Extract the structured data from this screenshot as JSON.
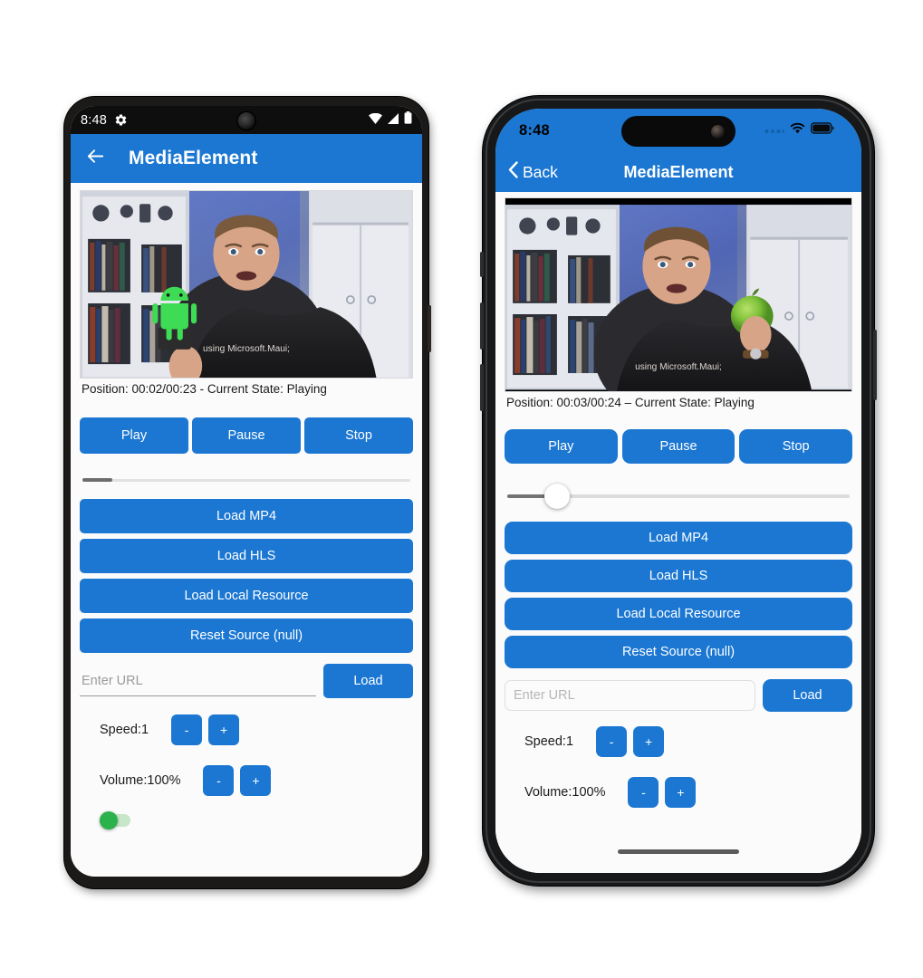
{
  "app": {
    "title": "MediaElement",
    "accent_color": "#1b77d2",
    "position_label_android": "Position: 00:02/00:23 - Current State: Playing",
    "position_label_ios": "Position: 00:03/00:24 – Current State: Playing"
  },
  "android": {
    "status_bar": {
      "time": "8:48",
      "gear_icon": "gear-icon",
      "wifi_icon": "wifi-icon",
      "signal_icon": "cellular-signal-icon",
      "battery_icon": "battery-icon"
    },
    "appbar": {
      "back_icon": "arrow-back-icon",
      "title": "MediaElement"
    },
    "transport": {
      "play": "Play",
      "pause": "Pause",
      "stop": "Stop"
    },
    "progress_percent": 9,
    "source_buttons": [
      "Load MP4",
      "Load HLS",
      "Load Local Resource",
      "Reset Source (null)"
    ],
    "url": {
      "placeholder": "Enter URL",
      "value": "",
      "load_label": "Load"
    },
    "speed": {
      "label": "Speed:1",
      "minus": "-",
      "plus": "+"
    },
    "volume": {
      "label": "Volume:100%",
      "minus": "-",
      "plus": "+"
    },
    "toggle": {
      "label": "",
      "state": "on"
    }
  },
  "ios": {
    "status_bar": {
      "time": "8:48",
      "dots_icon": "signal-dots-icon",
      "wifi_icon": "wifi-icon",
      "battery_icon": "battery-icon"
    },
    "navbar": {
      "back_label": "Back",
      "back_icon": "chevron-left-icon",
      "title": "MediaElement"
    },
    "transport": {
      "play": "Play",
      "pause": "Pause",
      "stop": "Stop"
    },
    "progress_percent": 15,
    "source_buttons": [
      "Load MP4",
      "Load HLS",
      "Load Local Resource",
      "Reset Source (null)"
    ],
    "url": {
      "placeholder": "Enter URL",
      "value": "",
      "load_label": "Load"
    },
    "speed": {
      "label": "Speed:1",
      "minus": "-",
      "plus": "+"
    },
    "volume": {
      "label": "Volume:100%",
      "minus": "-",
      "plus": "+"
    }
  }
}
